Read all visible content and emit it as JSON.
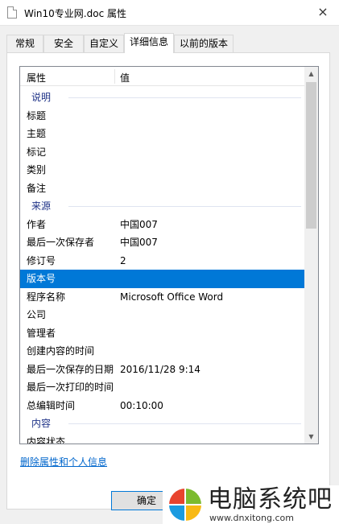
{
  "window": {
    "title": "Win10专业网.doc 属性",
    "close_icon": "×"
  },
  "tabs": [
    {
      "label": "常规",
      "active": false
    },
    {
      "label": "安全",
      "active": false
    },
    {
      "label": "自定义",
      "active": false
    },
    {
      "label": "详细信息",
      "active": true
    },
    {
      "label": "以前的版本",
      "active": false
    }
  ],
  "list": {
    "col_property": "属性",
    "col_value": "值",
    "rows": [
      {
        "type": "group",
        "label": "说明"
      },
      {
        "type": "item",
        "label": "标题",
        "value": ""
      },
      {
        "type": "item",
        "label": "主题",
        "value": ""
      },
      {
        "type": "item",
        "label": "标记",
        "value": ""
      },
      {
        "type": "item",
        "label": "类别",
        "value": ""
      },
      {
        "type": "item",
        "label": "备注",
        "value": ""
      },
      {
        "type": "group",
        "label": "来源"
      },
      {
        "type": "item",
        "label": "作者",
        "value": "中国007"
      },
      {
        "type": "item",
        "label": "最后一次保存者",
        "value": "中国007"
      },
      {
        "type": "item",
        "label": "修订号",
        "value": "2"
      },
      {
        "type": "item",
        "label": "版本号",
        "value": "",
        "selected": true
      },
      {
        "type": "item",
        "label": "程序名称",
        "value": "Microsoft Office Word"
      },
      {
        "type": "item",
        "label": "公司",
        "value": ""
      },
      {
        "type": "item",
        "label": "管理者",
        "value": ""
      },
      {
        "type": "item",
        "label": "创建内容的时间",
        "value": ""
      },
      {
        "type": "item",
        "label": "最后一次保存的日期",
        "value": "2016/11/28 9:14"
      },
      {
        "type": "item",
        "label": "最后一次打印的时间",
        "value": ""
      },
      {
        "type": "item",
        "label": "总编辑时间",
        "value": "00:10:00"
      },
      {
        "type": "group",
        "label": "内容"
      },
      {
        "type": "item",
        "label": "内容状态",
        "value": ""
      }
    ]
  },
  "remove_link": "删除属性和个人信息",
  "buttons": {
    "ok": "确定"
  },
  "watermark": {
    "title": "电脑系统吧",
    "url": "www.dnxitong.com"
  },
  "colors": {
    "selection": "#0078d7",
    "group_text": "#1e3287",
    "link": "#0066cc"
  }
}
